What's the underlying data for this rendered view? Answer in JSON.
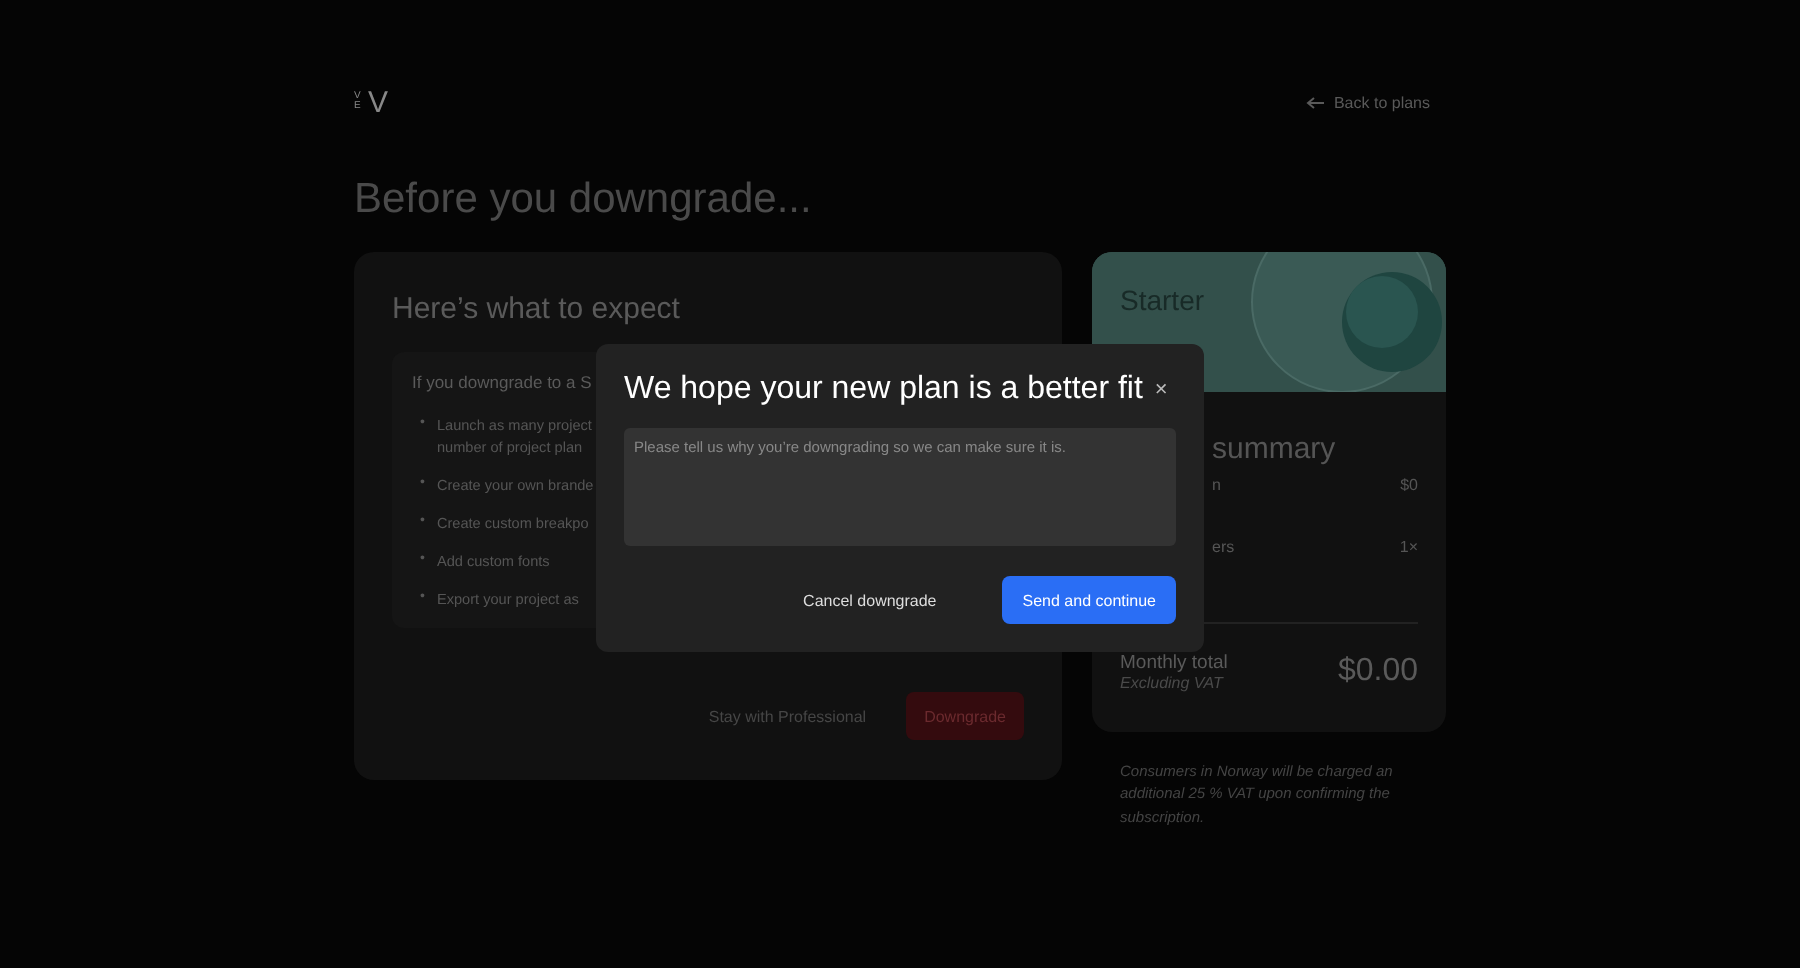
{
  "header": {
    "logo_small": "V E",
    "logo": "V",
    "back_link": "Back to plans"
  },
  "title": "Before you downgrade...",
  "expect_card": {
    "heading": "Here’s what to expect",
    "intro": "If you downgrade to a S",
    "bullet": "•",
    "items": [
      {
        "lines": [
          "Launch as many project",
          "number of project plan"
        ]
      },
      {
        "lines": [
          "Create your own brande"
        ]
      },
      {
        "lines": [
          "Create custom breakpo"
        ]
      },
      {
        "lines": [
          "Add custom fonts"
        ]
      },
      {
        "lines": [
          "Export your project as"
        ]
      }
    ],
    "buttons": [
      {
        "label": "Stay with Professional",
        "kind": "ghost"
      },
      {
        "label": "Downgrade",
        "kind": "danger"
      }
    ]
  },
  "summary_card": {
    "plan": "Starter",
    "heading": "summary",
    "rows": [
      {
        "label": "n",
        "value": "$0"
      },
      {
        "label": "ers",
        "value": "1×"
      }
    ],
    "total_label": "Monthly total",
    "total_note": "Excluding VAT",
    "total": "$0.00"
  },
  "vat_note": "Consumers in Norway will be charged an additional 25 % VAT upon confirming the subscription.",
  "dialog": {
    "title": "We hope your new plan is a better fit",
    "close": "×",
    "placeholder": "Please tell us why you’re downgrading so we can make sure it is.",
    "buttons": [
      {
        "label": "Cancel downgrade",
        "kind": "ghost"
      },
      {
        "label": "Send and continue",
        "kind": "primary"
      }
    ]
  }
}
